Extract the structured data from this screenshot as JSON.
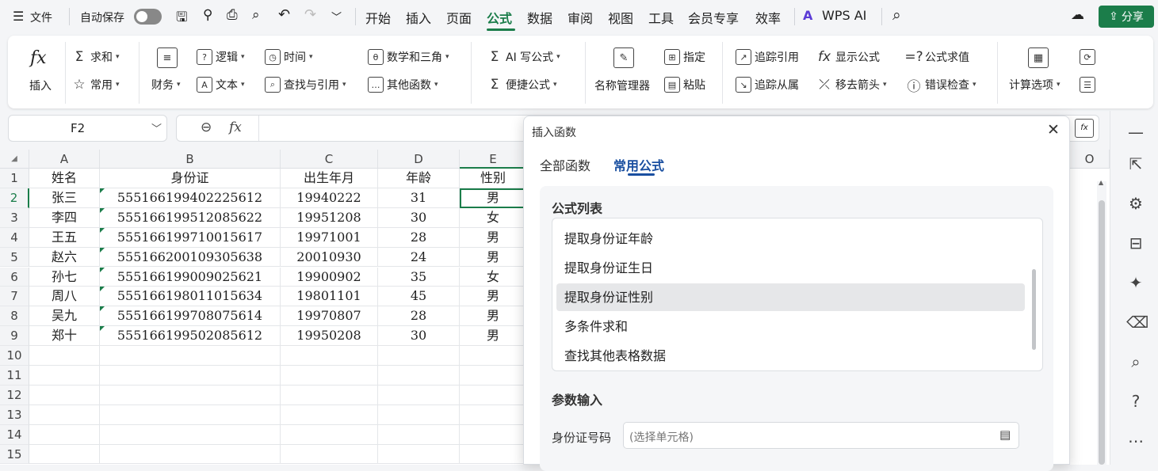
{
  "menubar": {
    "file": "文件",
    "autosave": "自动保存",
    "tabs": [
      "开始",
      "插入",
      "页面",
      "公式",
      "数据",
      "审阅",
      "视图",
      "工具",
      "会员专享",
      "效率"
    ],
    "ai": "WPS AI",
    "share": "分享"
  },
  "ribbon": {
    "insert": "插入",
    "sum": "求和",
    "common": "常用",
    "finance": "财务",
    "logic": "逻辑",
    "text": "文本",
    "time": "时间",
    "lookup": "查找与引用",
    "math": "数学和三角",
    "other": "其他函数",
    "ai_formula": "AI 写公式",
    "quick_formula": "便捷公式",
    "name_manager": "名称管理器",
    "assign": "指定",
    "paste": "粘贴",
    "trace_prec": "追踪引用",
    "trace_dep": "追踪从属",
    "show_formula": "显示公式",
    "remove_arrows": "移去箭头",
    "eval_formula": "公式求值",
    "error_check": "错误检查",
    "calc_options": "计算选项"
  },
  "formula_bar": {
    "cell_ref": "F2",
    "fx": "fx",
    "value": ""
  },
  "sheet": {
    "columns": [
      "A",
      "B",
      "C",
      "D",
      "E"
    ],
    "extra_col": "O",
    "rows": [
      "1",
      "2",
      "3",
      "4",
      "5",
      "6",
      "7",
      "8",
      "9",
      "10",
      "11",
      "12",
      "13",
      "14",
      "15"
    ],
    "header": [
      "姓名",
      "身份证",
      "出生年月",
      "年龄",
      "性别"
    ],
    "data": [
      [
        "张三",
        "555166199402225612",
        "19940222",
        "31",
        "男"
      ],
      [
        "李四",
        "555166199512085622",
        "19951208",
        "30",
        "女"
      ],
      [
        "王五",
        "555166199710015617",
        "19971001",
        "28",
        "男"
      ],
      [
        "赵六",
        "555166200109305638",
        "20010930",
        "24",
        "男"
      ],
      [
        "孙七",
        "555166199009025621",
        "19900902",
        "35",
        "女"
      ],
      [
        "周八",
        "555166198011015634",
        "19801101",
        "45",
        "男"
      ],
      [
        "吴九",
        "555166199708075614",
        "19970807",
        "28",
        "男"
      ],
      [
        "郑十",
        "555166199502085612",
        "19950208",
        "30",
        "男"
      ]
    ]
  },
  "dialog": {
    "title": "插入函数",
    "tabs": [
      "全部函数",
      "常用公式"
    ],
    "active_tab": 1,
    "list_title": "公式列表",
    "list": [
      "提取身份证年龄",
      "提取身份证生日",
      "提取身份证性别",
      "多条件求和",
      "查找其他表格数据"
    ],
    "selected": 2,
    "param_title": "参数输入",
    "param_label": "身份证号码",
    "param_placeholder": "(选择单元格)"
  },
  "colors": {
    "accent": "#1b7d4a",
    "dialog_tab_active": "#1a4fa0"
  }
}
